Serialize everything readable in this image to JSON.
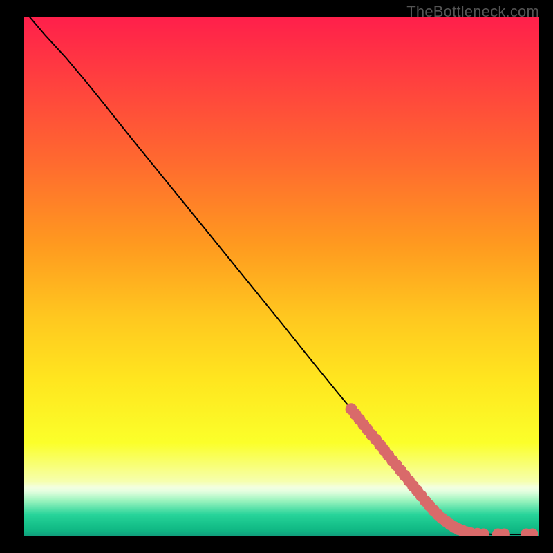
{
  "watermark": "TheBottleneck.com",
  "colors": {
    "bg": "#000000",
    "line": "#000000",
    "marker": "#d96a6a",
    "watermark": "#555555"
  },
  "gradient_stops": [
    {
      "offset": 0.0,
      "color": "#ff1f4b"
    },
    {
      "offset": 0.12,
      "color": "#ff3f3f"
    },
    {
      "offset": 0.28,
      "color": "#ff6a2f"
    },
    {
      "offset": 0.44,
      "color": "#ff9a1f"
    },
    {
      "offset": 0.58,
      "color": "#ffc81f"
    },
    {
      "offset": 0.7,
      "color": "#ffe61f"
    },
    {
      "offset": 0.82,
      "color": "#fbff2a"
    },
    {
      "offset": 0.895,
      "color": "#f6ffb0"
    },
    {
      "offset": 0.905,
      "color": "#f3ffe0"
    },
    {
      "offset": 0.913,
      "color": "#e6ffe0"
    },
    {
      "offset": 0.93,
      "color": "#a0f5c0"
    },
    {
      "offset": 0.958,
      "color": "#28d49a"
    },
    {
      "offset": 0.975,
      "color": "#18c48c"
    },
    {
      "offset": 0.988,
      "color": "#10b884"
    },
    {
      "offset": 1.0,
      "color": "#109c7c"
    }
  ],
  "chart_data": {
    "type": "line",
    "title": "",
    "xlabel": "",
    "ylabel": "",
    "xlim": [
      0,
      100
    ],
    "ylim": [
      0,
      100
    ],
    "curve": [
      {
        "x": 1.0,
        "y": 100.0
      },
      {
        "x": 4.0,
        "y": 96.5
      },
      {
        "x": 8.0,
        "y": 92.2
      },
      {
        "x": 12.0,
        "y": 87.5
      },
      {
        "x": 16.0,
        "y": 82.6
      },
      {
        "x": 20.0,
        "y": 77.6
      },
      {
        "x": 25.0,
        "y": 71.5
      },
      {
        "x": 30.0,
        "y": 65.4
      },
      {
        "x": 35.0,
        "y": 59.3
      },
      {
        "x": 40.0,
        "y": 53.2
      },
      {
        "x": 45.0,
        "y": 47.1
      },
      {
        "x": 50.0,
        "y": 41.0
      },
      {
        "x": 55.0,
        "y": 34.8
      },
      {
        "x": 60.0,
        "y": 28.7
      },
      {
        "x": 63.0,
        "y": 25.1
      },
      {
        "x": 65.0,
        "y": 22.6
      },
      {
        "x": 68.0,
        "y": 18.9
      },
      {
        "x": 70.0,
        "y": 16.5
      },
      {
        "x": 73.0,
        "y": 12.8
      },
      {
        "x": 76.0,
        "y": 9.1
      },
      {
        "x": 79.0,
        "y": 5.5
      },
      {
        "x": 82.0,
        "y": 2.8
      },
      {
        "x": 85.0,
        "y": 1.2
      },
      {
        "x": 88.0,
        "y": 0.6
      },
      {
        "x": 91.0,
        "y": 0.4
      },
      {
        "x": 94.0,
        "y": 0.4
      },
      {
        "x": 97.0,
        "y": 0.4
      },
      {
        "x": 99.0,
        "y": 0.4
      }
    ],
    "markers": [
      {
        "x": 63.5,
        "y": 24.5
      },
      {
        "x": 64.3,
        "y": 23.5
      },
      {
        "x": 65.1,
        "y": 22.5
      },
      {
        "x": 65.9,
        "y": 21.5
      },
      {
        "x": 66.7,
        "y": 20.5
      },
      {
        "x": 67.5,
        "y": 19.5
      },
      {
        "x": 68.3,
        "y": 18.6
      },
      {
        "x": 69.1,
        "y": 17.6
      },
      {
        "x": 69.9,
        "y": 16.6
      },
      {
        "x": 70.7,
        "y": 15.6
      },
      {
        "x": 71.5,
        "y": 14.6
      },
      {
        "x": 72.3,
        "y": 13.7
      },
      {
        "x": 73.1,
        "y": 12.7
      },
      {
        "x": 73.9,
        "y": 11.7
      },
      {
        "x": 74.7,
        "y": 10.7
      },
      {
        "x": 75.5,
        "y": 9.7
      },
      {
        "x": 76.3,
        "y": 8.8
      },
      {
        "x": 77.1,
        "y": 7.8
      },
      {
        "x": 77.9,
        "y": 6.8
      },
      {
        "x": 78.7,
        "y": 5.9
      },
      {
        "x": 79.5,
        "y": 5.0
      },
      {
        "x": 80.3,
        "y": 4.2
      },
      {
        "x": 81.1,
        "y": 3.5
      },
      {
        "x": 81.9,
        "y": 2.9
      },
      {
        "x": 82.7,
        "y": 2.3
      },
      {
        "x": 83.5,
        "y": 1.8
      },
      {
        "x": 84.3,
        "y": 1.4
      },
      {
        "x": 85.1,
        "y": 1.1
      },
      {
        "x": 85.9,
        "y": 0.8
      },
      {
        "x": 86.7,
        "y": 0.6
      },
      {
        "x": 88.0,
        "y": 0.5
      },
      {
        "x": 89.2,
        "y": 0.4
      },
      {
        "x": 92.0,
        "y": 0.4
      },
      {
        "x": 93.2,
        "y": 0.4
      },
      {
        "x": 97.5,
        "y": 0.4
      },
      {
        "x": 98.7,
        "y": 0.4
      }
    ],
    "marker_radius": 8.5
  }
}
